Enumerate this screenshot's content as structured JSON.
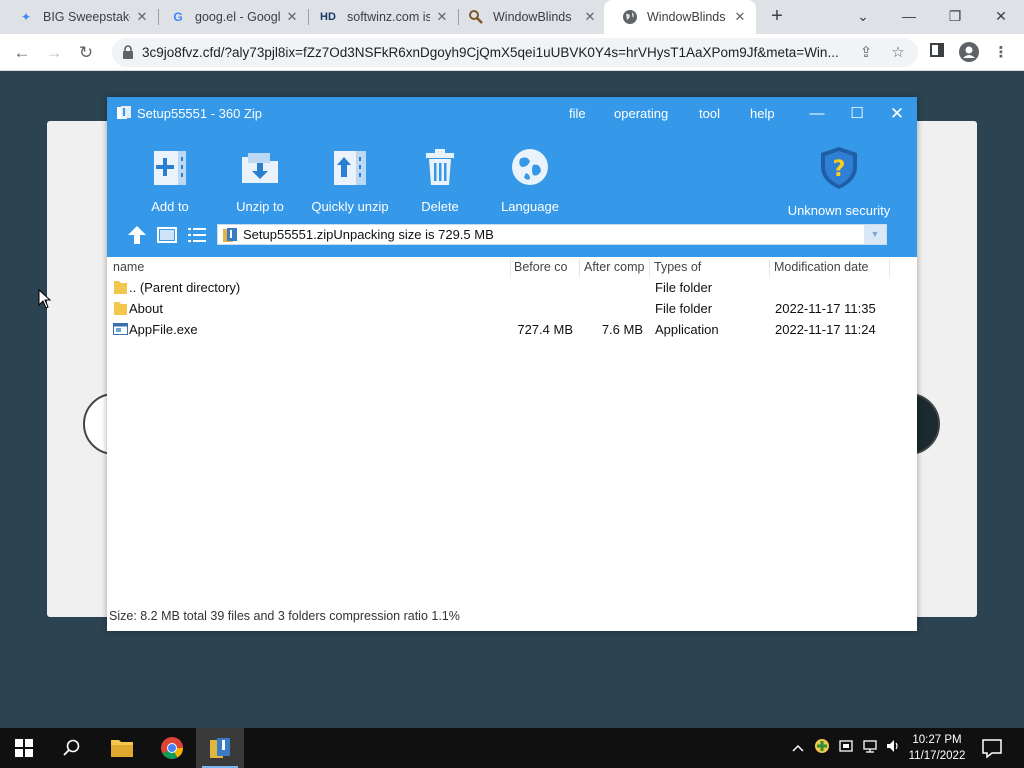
{
  "browser": {
    "tabs": [
      {
        "title": "BIG Sweepstakes",
        "icon": "sparkle-icon",
        "active": false
      },
      {
        "title": "goog.el - Googl",
        "icon": "google-icon",
        "active": false
      },
      {
        "title": "softwinz.com is",
        "icon": "hd-icon",
        "active": false
      },
      {
        "title": "WindowBlinds",
        "icon": "magnifier-icon",
        "active": false
      },
      {
        "title": "WindowBlinds -",
        "icon": "globe-icon",
        "active": true
      }
    ],
    "url": "3c9jo8fvz.cfd/?aly73pjl8ix=fZz7Od3NSFkR6xnDgoyh9CjQmX5qei1uUBVK0Y4s=hrVHysT1AaXPom9Jf&meta=Win..."
  },
  "zip": {
    "title": "Setup55551 - 360 Zip",
    "menu": {
      "file": "file",
      "operating": "operating",
      "tool": "tool",
      "help": "help"
    },
    "tools": {
      "add": "Add to",
      "unzip": "Unzip to",
      "quick": "Quickly unzip",
      "delete": "Delete",
      "language": "Language",
      "security": "Unknown security"
    },
    "path": "Setup55551.zipUnpacking size is 729.5 MB",
    "columns": {
      "name": "name",
      "before": "Before co",
      "after": "After comp",
      "type": "Types of",
      "date": "Modification date"
    },
    "rows": [
      {
        "name": ".. (Parent directory)",
        "before": "",
        "after": "",
        "type": "File folder",
        "date": ""
      },
      {
        "name": "About",
        "before": "",
        "after": "",
        "type": "File folder",
        "date": "2022-11-17 11:35"
      },
      {
        "name": "AppFile.exe",
        "before": "727.4 MB",
        "after": "7.6 MB",
        "type": "Application",
        "date": "2022-11-17 11:24"
      }
    ],
    "status": "Size: 8.2 MB total 39 files and 3 folders compression ratio 1.1%"
  },
  "taskbar": {
    "time": "10:27 PM",
    "date": "11/17/2022"
  },
  "colors": {
    "zip_blue": "#3598e8",
    "page_bg": "#2c4452",
    "taskbar": "#101010"
  }
}
